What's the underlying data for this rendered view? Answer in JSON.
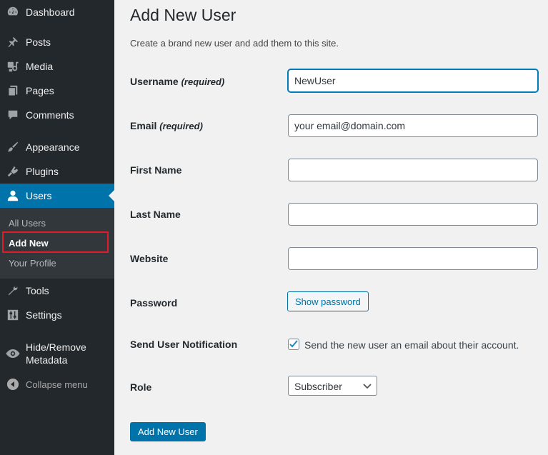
{
  "sidebar": {
    "items": [
      {
        "label": "Dashboard",
        "icon": "dashboard-icon"
      },
      {
        "label": "Posts",
        "icon": "pushpin-icon"
      },
      {
        "label": "Media",
        "icon": "media-icon"
      },
      {
        "label": "Pages",
        "icon": "pages-icon"
      },
      {
        "label": "Comments",
        "icon": "comment-icon"
      },
      {
        "label": "Appearance",
        "icon": "paintbrush-icon"
      },
      {
        "label": "Plugins",
        "icon": "plug-icon"
      },
      {
        "label": "Users",
        "icon": "user-icon"
      },
      {
        "label": "Tools",
        "icon": "wrench-icon"
      },
      {
        "label": "Settings",
        "icon": "settings-sliders-icon"
      },
      {
        "label": "Hide/Remove",
        "label2": "Metadata",
        "icon": "eye-icon"
      },
      {
        "label": "Collapse menu",
        "icon": "collapse-arrow-icon"
      }
    ],
    "users_submenu": [
      {
        "label": "All Users"
      },
      {
        "label": "Add New"
      },
      {
        "label": "Your Profile"
      }
    ]
  },
  "main": {
    "title": "Add New User",
    "description": "Create a brand new user and add them to this site.",
    "fields": {
      "username": {
        "label": "Username",
        "required": "(required)",
        "value": "NewUser"
      },
      "email": {
        "label": "Email",
        "required": "(required)",
        "value": "your email@domain.com"
      },
      "first_name": {
        "label": "First Name",
        "value": ""
      },
      "last_name": {
        "label": "Last Name",
        "value": ""
      },
      "website": {
        "label": "Website",
        "value": ""
      },
      "password": {
        "label": "Password",
        "button": "Show password"
      },
      "notification": {
        "label": "Send User Notification",
        "checked": true,
        "text": "Send the new user an email about their account."
      },
      "role": {
        "label": "Role",
        "value": "Subscriber"
      }
    },
    "submit_label": "Add New User"
  },
  "colors": {
    "sidebar_bg": "#23282d",
    "submenu_bg": "#32373c",
    "accent": "#0073aa",
    "highlight": "#e21b2b"
  }
}
